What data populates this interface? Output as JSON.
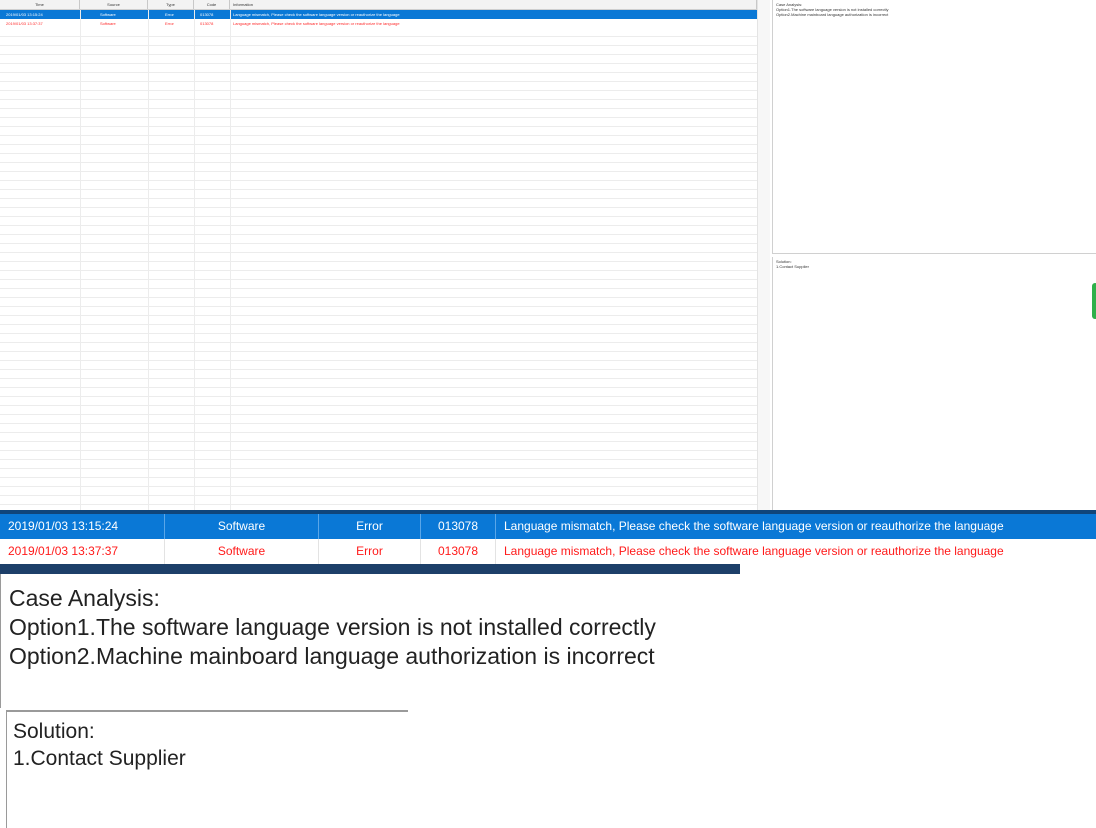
{
  "columns": [
    "Time",
    "Source",
    "Type",
    "Code",
    "Information"
  ],
  "rows": [
    {
      "time": "2019/01/03 13:15:24",
      "source": "Software",
      "type": "Error",
      "code": "013078",
      "info": "Language mismatch, Please check the software language version or reauthorize the language",
      "selected": true
    },
    {
      "time": "2019/01/03 13:37:37",
      "source": "Software",
      "type": "Error",
      "code": "013078",
      "info": "Language mismatch, Please check the software language version or reauthorize the language",
      "selected": false
    }
  ],
  "case_analysis": {
    "title": "Case Analysis:",
    "options": [
      "Option1.The software language version is not installed correctly",
      "Option2.Machine mainboard language authorization is incorrect"
    ]
  },
  "solution": {
    "title": "Solution:",
    "items": [
      "1.Contact Supplier"
    ]
  },
  "colors": {
    "selected_row": "#0a78d6",
    "error_text": "#ff1a1a"
  }
}
